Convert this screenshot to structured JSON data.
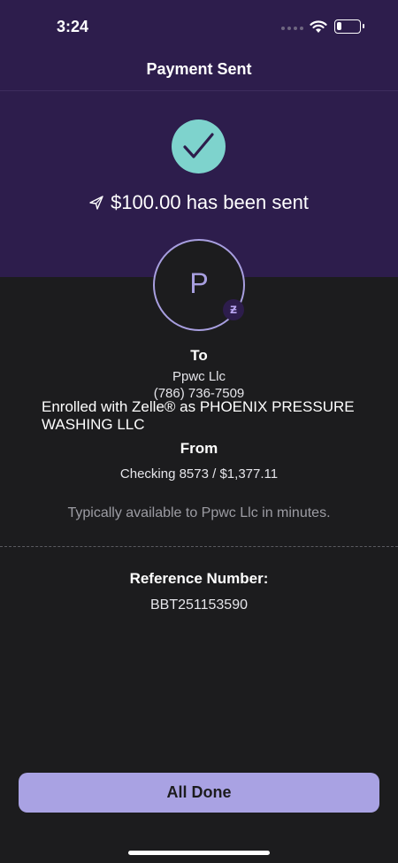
{
  "status_bar": {
    "time": "3:24",
    "battery_level": 0.2
  },
  "nav": {
    "title": "Payment Sent"
  },
  "confirmation": {
    "icon": "checkmark-icon",
    "send_icon": "paper-plane-icon",
    "message": "$100.00 has been sent"
  },
  "recipient": {
    "avatar_letter": "P",
    "badge_icon": "zelle-icon",
    "badge_glyph": "ƶ",
    "to_label": "To",
    "name": "Ppwc Llc",
    "phone": "(786) 736-7509",
    "enrolled_text": "Enrolled with Zelle® as PHOENIX PRESSURE WASHING LLC"
  },
  "sender": {
    "from_label": "From",
    "account": "Checking 8573 / $1,377.11"
  },
  "availability": {
    "text": "Typically available to Ppwc Llc in minutes."
  },
  "reference": {
    "label": "Reference Number:",
    "value": "BBT251153590"
  },
  "actions": {
    "done_label": "All Done"
  },
  "colors": {
    "header_bg": "#2d1d4c",
    "body_bg": "#1c1c1e",
    "accent": "#a9a2e3",
    "check_bg": "#7ed3cd"
  }
}
